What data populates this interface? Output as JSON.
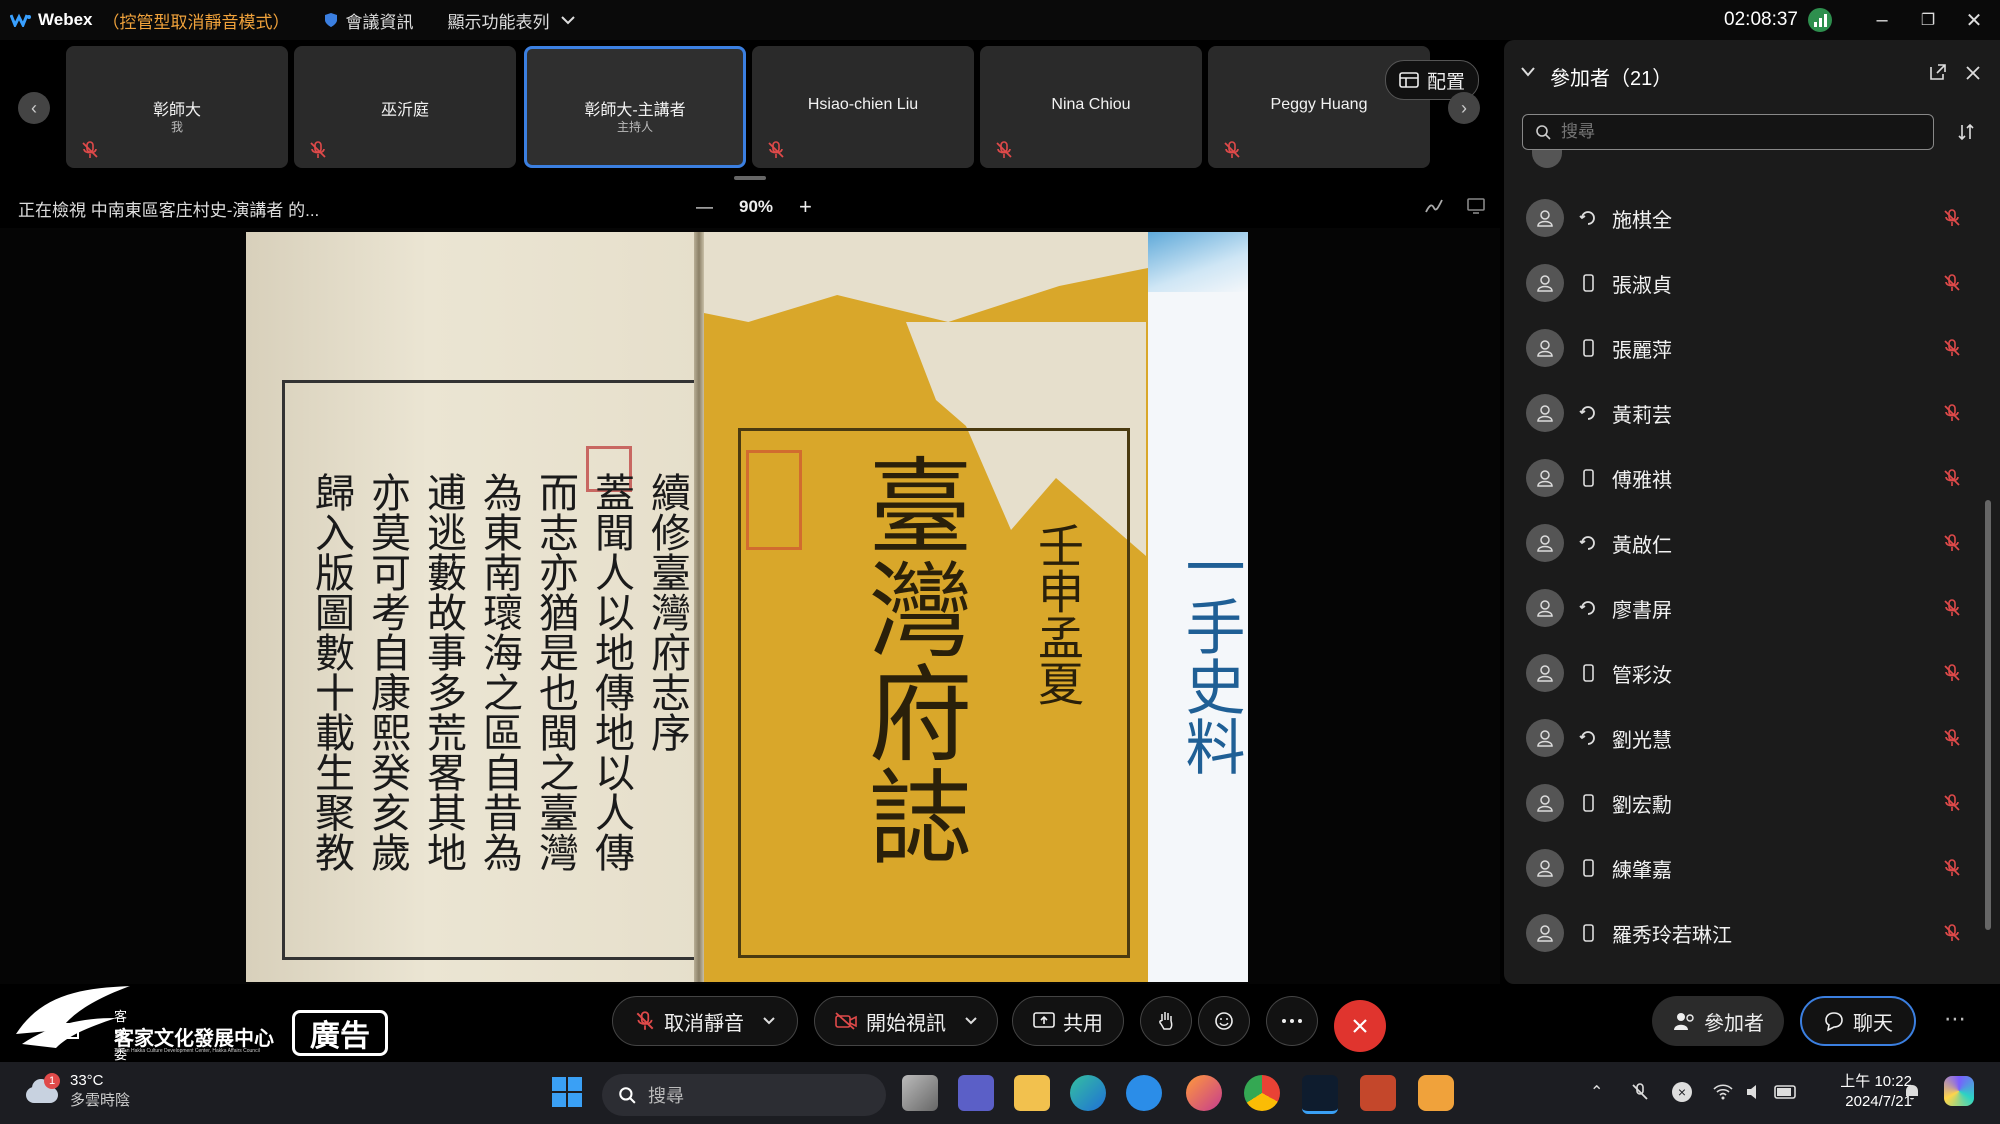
{
  "titlebar": {
    "app_name": "Webex",
    "mode": "（控管型取消靜音模式）",
    "meeting_info": "會議資訊",
    "view_menu": "顯示功能表列",
    "clock": "02:08:37"
  },
  "video_strip": {
    "tiles": [
      {
        "name": "彰師大",
        "sub": "我"
      },
      {
        "name": "巫沂庭",
        "sub": ""
      },
      {
        "name": "彰師大-主講者",
        "sub": "主持人"
      },
      {
        "name": "Hsiao-chien Liu",
        "sub": ""
      },
      {
        "name": "Nina Chiou",
        "sub": ""
      },
      {
        "name": "Peggy Huang",
        "sub": ""
      }
    ],
    "layout_label": "配置"
  },
  "share": {
    "title": "正在檢視 中南東區客庄村史-演講者 的...",
    "zoom": "90%"
  },
  "content": {
    "left_page_columns": [
      "續修臺灣府志序",
      "蓋聞人以地傳地以人傳",
      "而志亦猶是也閩之臺灣",
      "為東南瓌海之區自昔為",
      "逋逃藪故事多荒畧其地",
      "亦莫可考自康熙癸亥歲",
      "歸入版圖數十載生聚教"
    ],
    "right_page_title": "臺灣府誌",
    "right_page_year": "壬申孟夏",
    "slide_text": "一手史料"
  },
  "participants": {
    "title": "參加者（21）",
    "search_placeholder": "搜尋",
    "items": [
      {
        "name": "施棋全",
        "device": "phone-call-icon"
      },
      {
        "name": "張淑貞",
        "device": "mobile-icon"
      },
      {
        "name": "張麗萍",
        "device": "mobile-icon"
      },
      {
        "name": "黃莉芸",
        "device": "phone-call-icon"
      },
      {
        "name": "傅雅祺",
        "device": "mobile-icon"
      },
      {
        "name": "黃啟仁",
        "device": "phone-call-icon"
      },
      {
        "name": "廖書屏",
        "device": "phone-call-icon"
      },
      {
        "name": "管彩汝",
        "device": "mobile-icon"
      },
      {
        "name": "劉光慧",
        "device": "phone-call-icon"
      },
      {
        "name": "劉宏勳",
        "device": "mobile-icon"
      },
      {
        "name": "練肇嘉",
        "device": "mobile-icon"
      },
      {
        "name": "羅秀玲若琳江",
        "device": "mobile-icon"
      }
    ]
  },
  "controls": {
    "unmute": "取消靜音",
    "start_video": "開始視訊",
    "share": "共用",
    "participants": "參加者",
    "chat": "聊天"
  },
  "ad": {
    "org_small": "客家委員會",
    "org_name": "客家文化發展中心",
    "org_en": "Taiwan Hakka Culture Development Center, Hakka Affairs Council",
    "badge": "廣告"
  },
  "taskbar": {
    "notif_count": "1",
    "temperature": "33°C",
    "weather": "多雲時陰",
    "search": "搜尋",
    "time": "上午 10:22",
    "date": "2024/7/21"
  },
  "colors": {
    "accent_blue": "#3b7fe0",
    "mode_orange": "#f0a23b",
    "leave_red": "#e0342e",
    "muted_red": "#e04a4a"
  }
}
